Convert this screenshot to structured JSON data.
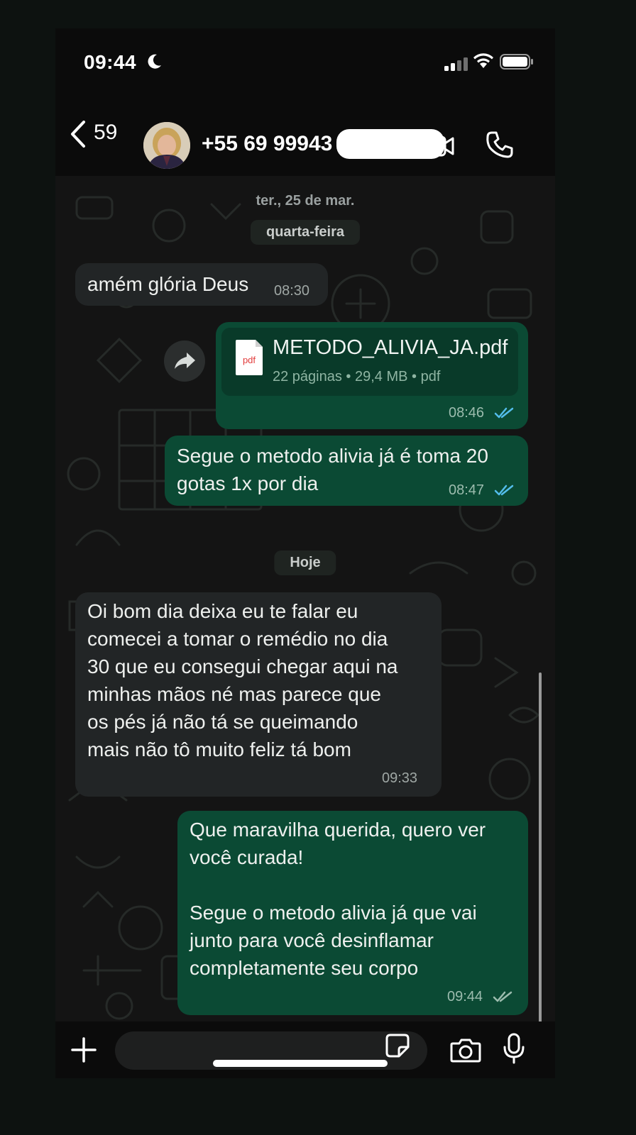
{
  "status_bar": {
    "time": "09:44"
  },
  "header": {
    "back_count": "59",
    "contact_name": "+55 69 99943"
  },
  "dates": {
    "faded": "ter., 25 de mar.",
    "wednesday": "quarta-feira",
    "today": "Hoje"
  },
  "messages": [
    {
      "direction": "in",
      "text": "amém glória Deus",
      "time": "08:30"
    },
    {
      "direction": "out",
      "type": "document",
      "file_name": "METODO_ALIVIA_JA.pdf",
      "file_icon_label": "pdf",
      "file_meta": "22 páginas • 29,4 MB • pdf",
      "time": "08:46",
      "status": "read"
    },
    {
      "direction": "out",
      "text": "Segue o metodo alivia já é toma 20\ngotas 1x por dia",
      "time": "08:47",
      "status": "read"
    },
    {
      "direction": "in",
      "text": "Oi bom dia deixa eu te falar eu\ncomecei a tomar o remédio no dia\n30 que eu consegui chegar aqui na\nminhas mãos né mas parece que\nos pés já não tá se queimando\nmais não tô muito feliz tá bom",
      "time": "09:33"
    },
    {
      "direction": "out",
      "text": "Que maravilha querida, quero ver\nvocê curada!\n\nSegue o metodo alivia já que vai\njunto para você desinflamar\ncompletamente seu corpo",
      "time": "09:44",
      "status": "delivered"
    }
  ],
  "colors": {
    "incoming_bubble": "#222526",
    "outgoing_bubble": "#0b4a34",
    "read_tick": "#53bdeb",
    "delivered_tick": "#9cbcae"
  },
  "icons": [
    "moon-icon",
    "signal-icon",
    "wifi-icon",
    "battery-icon",
    "back-chevron-icon",
    "video-call-icon",
    "phone-call-icon",
    "forward-icon",
    "pdf-file-icon",
    "plus-icon",
    "sticker-icon",
    "camera-icon",
    "microphone-icon"
  ]
}
